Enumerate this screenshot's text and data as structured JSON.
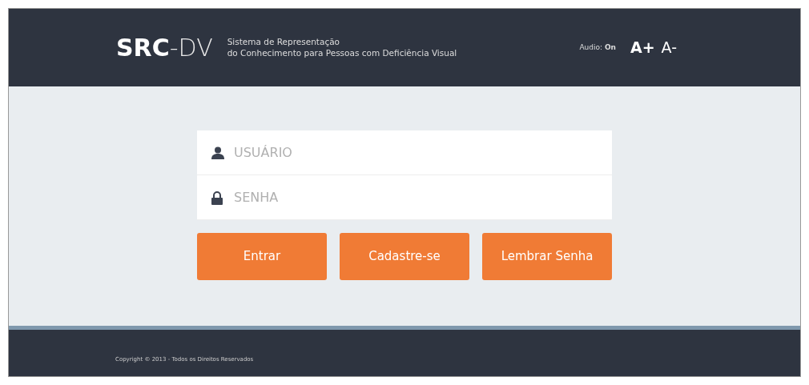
{
  "header": {
    "logo_bold": "SRC",
    "logo_light": "-DV",
    "tagline_1": "Sistema de Representação",
    "tagline_2": "do Conhecimento para Pessoas com Deficiência Visual",
    "audio": "Audio: **On**",
    "font_buttons": [
      "A+",
      "A-"
    ]
  },
  "login": {
    "fields": [
      {
        "kind": "user",
        "placeholder": "USUÁRIO"
      },
      {
        "kind": "password",
        "placeholder": "SENHA"
      }
    ],
    "buttons": [
      "Entrar",
      "Cadastre-se",
      "Lembrar Senha"
    ]
  },
  "footer": {
    "copyright": "Copyright © 2013 - Todos os Direitos Reservados"
  }
}
